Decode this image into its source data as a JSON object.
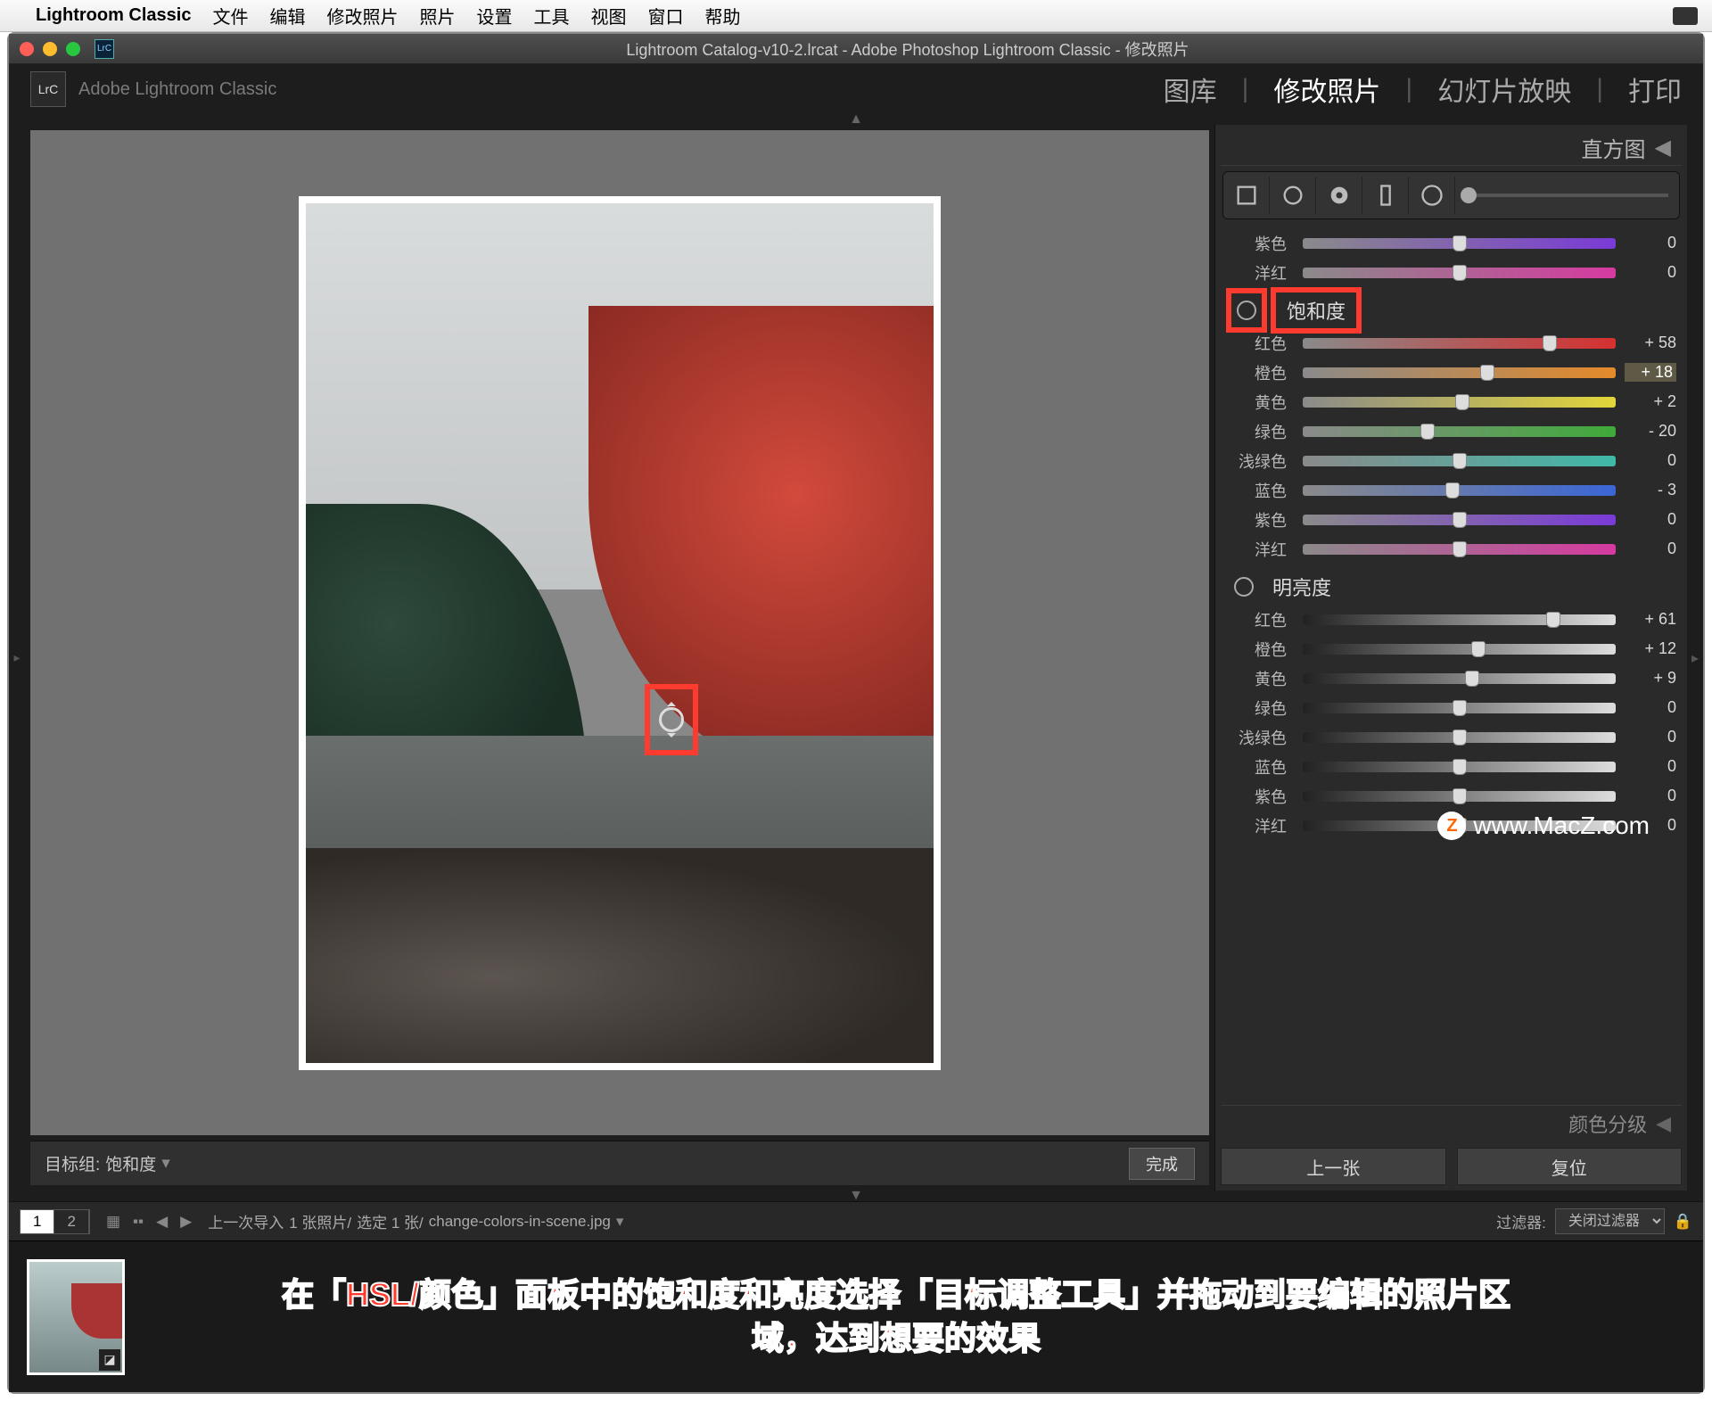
{
  "menubar": {
    "app": "Lightroom Classic",
    "items": [
      "文件",
      "编辑",
      "修改照片",
      "照片",
      "设置",
      "工具",
      "视图",
      "窗口",
      "帮助"
    ]
  },
  "titlebar": {
    "badge": "LrC",
    "title": "Lightroom Catalog-v10-2.lrcat - Adobe Photoshop Lightroom Classic - 修改照片"
  },
  "identity": {
    "badge": "LrC",
    "name": "Adobe Lightroom Classic"
  },
  "modules": {
    "items": [
      "图库",
      "修改照片",
      "幻灯片放映",
      "打印"
    ],
    "active": "修改照片",
    "sep": "|"
  },
  "rightPanel": {
    "histogramTitle": "直方图",
    "hueTail": [
      {
        "label": "紫色",
        "value": "0",
        "pos": 50,
        "grad": "grad-purple"
      },
      {
        "label": "洋红",
        "value": "0",
        "pos": 50,
        "grad": "grad-magenta"
      }
    ],
    "satTitle": "饱和度",
    "saturation": [
      {
        "label": "红色",
        "value": "+ 58",
        "pos": 79,
        "grad": "grad-red"
      },
      {
        "label": "橙色",
        "value": "+ 18",
        "pos": 59,
        "grad": "grad-orange",
        "highlight": true
      },
      {
        "label": "黄色",
        "value": "+ 2",
        "pos": 51,
        "grad": "grad-yellow"
      },
      {
        "label": "绿色",
        "value": "- 20",
        "pos": 40,
        "grad": "grad-green"
      },
      {
        "label": "浅绿色",
        "value": "0",
        "pos": 50,
        "grad": "grad-aqua"
      },
      {
        "label": "蓝色",
        "value": "- 3",
        "pos": 48,
        "grad": "grad-blue"
      },
      {
        "label": "紫色",
        "value": "0",
        "pos": 50,
        "grad": "grad-purple"
      },
      {
        "label": "洋红",
        "value": "0",
        "pos": 50,
        "grad": "grad-magenta"
      }
    ],
    "lumTitle": "明亮度",
    "luminance": [
      {
        "label": "红色",
        "value": "+ 61",
        "pos": 80
      },
      {
        "label": "橙色",
        "value": "+ 12",
        "pos": 56
      },
      {
        "label": "黄色",
        "value": "+ 9",
        "pos": 54
      },
      {
        "label": "绿色",
        "value": "0",
        "pos": 50
      },
      {
        "label": "浅绿色",
        "value": "0",
        "pos": 50
      },
      {
        "label": "蓝色",
        "value": "0",
        "pos": 50
      },
      {
        "label": "紫色",
        "value": "0",
        "pos": 50
      },
      {
        "label": "洋红",
        "value": "0",
        "pos": 50
      }
    ],
    "colorGradingTitle": "颜色分级",
    "prev": "上一张",
    "reset": "复位"
  },
  "targetBar": {
    "label": "目标组:",
    "value": "饱和度",
    "done": "完成"
  },
  "footer": {
    "seg1": "1",
    "seg2": "2",
    "crumbLabel": "上一次导入",
    "count": "1 张照片/",
    "selected": "选定 1 张/",
    "filename": "change-colors-in-scene.jpg",
    "filterLabel": "过滤器:",
    "filterValue": "关闭过滤器"
  },
  "annotation": {
    "line1": "在「HSL/颜色」面板中的饱和度和亮度选择「目标调整工具」并拖动到要编辑的照片区",
    "line2": "域，达到想要的效果"
  },
  "watermark": "www.MacZ.com"
}
